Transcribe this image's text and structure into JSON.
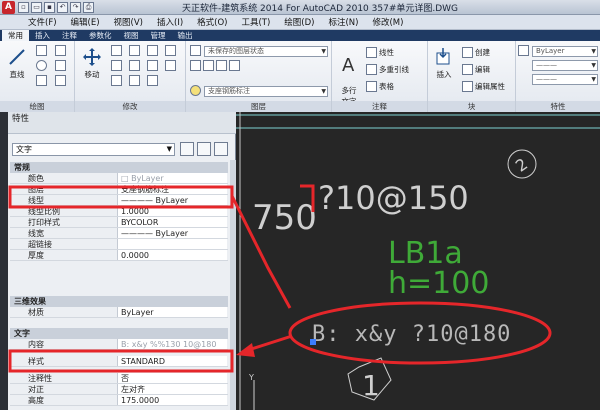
{
  "titlebar": {
    "title": "天正软件-建筑系统 2014  For AutoCAD 2010      357#单元详图.DWG",
    "logo": "A"
  },
  "menu": [
    "文件(F)",
    "编辑(E)",
    "视图(V)",
    "插入(I)",
    "格式(O)",
    "工具(T)",
    "绘图(D)",
    "标注(N)",
    "修改(M)"
  ],
  "ribbon_tabs": [
    "常用",
    "插入",
    "注释",
    "参数化",
    "视图",
    "管理",
    "输出"
  ],
  "ribbon": {
    "panels": {
      "draw": "绘图",
      "modify": "修改",
      "layers": "图层",
      "annotation": "注释",
      "block": "块",
      "properties": "特性"
    },
    "buttons": {
      "line": "直线",
      "move": "移动",
      "mtext": "多行\n文字",
      "insert": "插入",
      "linear": "线性",
      "mleader": "多重引线",
      "table": "表格",
      "create": "创建",
      "edit": "编辑",
      "edit_attr": "编辑属性"
    },
    "layer_state": "未保存的图层状态",
    "current_layer": "支座钢筋标注",
    "bylayer": "ByLayer"
  },
  "palette": {
    "title": "特性",
    "object_type": "文字",
    "sections": {
      "general": "常规",
      "3d": "三维效果",
      "text": "文字"
    },
    "general_rows": [
      {
        "k": "颜色",
        "v": "□ ByLayer"
      },
      {
        "k": "图层",
        "v": "支座钢筋标注"
      },
      {
        "k": "线型",
        "v": "———— ByLayer"
      },
      {
        "k": "线型比例",
        "v": "1.0000"
      },
      {
        "k": "打印样式",
        "v": "BYCOLOR"
      },
      {
        "k": "线宽",
        "v": "———— ByLayer"
      },
      {
        "k": "超链接",
        "v": ""
      },
      {
        "k": "厚度",
        "v": "0.0000"
      }
    ],
    "material_row": {
      "k": "材质",
      "v": "ByLayer"
    },
    "text_rows": [
      {
        "k": "内容",
        "v": "B: x&y %%130 10@180"
      },
      {
        "k": "样式",
        "v": "STANDARD"
      },
      {
        "k": "注释性",
        "v": "否"
      },
      {
        "k": "对正",
        "v": "左对齐"
      },
      {
        "k": "高度",
        "v": "175.0000"
      }
    ]
  },
  "drawing": {
    "dim_750": "750",
    "rebar_top": "?10@150",
    "lb1a": "LB1a",
    "h100": "h=100",
    "rebar_b": "B: x&y ?10@180",
    "axis_2": "2",
    "axis_1": "1",
    "y_axis": "Y"
  },
  "colors": {
    "annotation_red": "#e5262a",
    "green_text": "#3faa38",
    "drawing_text": "#cfcfcf",
    "cyan_line": "#7fd3d3"
  }
}
